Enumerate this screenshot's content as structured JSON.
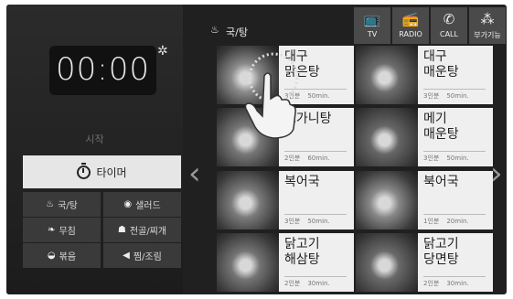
{
  "left": {
    "timer_display": "00:00",
    "start_label": "시작",
    "timer_button_label": "타이머",
    "categories": [
      {
        "label": "국/탕",
        "icon": "soup-bowl-icon",
        "glyph": "♨"
      },
      {
        "label": "샐러드",
        "icon": "salad-plate-icon",
        "glyph": "◉"
      },
      {
        "label": "무침",
        "icon": "vegetable-icon",
        "glyph": "❧"
      },
      {
        "label": "전골/찌개",
        "icon": "hot-pot-icon",
        "glyph": "☗"
      },
      {
        "label": "볶음",
        "icon": "stir-fry-pan-icon",
        "glyph": "◒"
      },
      {
        "label": "찜/조림",
        "icon": "fish-icon",
        "glyph": "◀"
      }
    ]
  },
  "header": {
    "title": "국/탕",
    "icon": "soup-bowl-icon"
  },
  "top_buttons": [
    {
      "label": "TV",
      "icon": "tv-icon",
      "glyph": "📺"
    },
    {
      "label": "RADIO",
      "icon": "radio-icon",
      "glyph": "📻"
    },
    {
      "label": "CALL",
      "icon": "phone-icon",
      "glyph": "✆"
    },
    {
      "label": "부가기능",
      "icon": "extra-functions-icon",
      "glyph": "⁂"
    }
  ],
  "recipes": [
    {
      "name": "대구\n맑은탕",
      "servings": "3인분",
      "time": "50min.",
      "tone": "#8a8a8a"
    },
    {
      "name": "대구\n매운탕",
      "servings": "3인분",
      "time": "50min.",
      "tone": "#6d6d6d"
    },
    {
      "name": "도가니탕",
      "servings": "2인분",
      "time": "60min.",
      "tone": "#777"
    },
    {
      "name": "메기\n매운탕",
      "servings": "3인분",
      "time": "50min.",
      "tone": "#666"
    },
    {
      "name": "복어국",
      "servings": "3인분",
      "time": "50min.",
      "tone": "#7b7b7b"
    },
    {
      "name": "북어국",
      "servings": "1인분",
      "time": "20min.",
      "tone": "#888"
    },
    {
      "name": "닭고기\n해삼탕",
      "servings": "2인분",
      "time": "30min.",
      "tone": "#747474"
    },
    {
      "name": "닭고기\n당면탕",
      "servings": "2인분",
      "time": "30min.",
      "tone": "#6a6a6a"
    }
  ]
}
